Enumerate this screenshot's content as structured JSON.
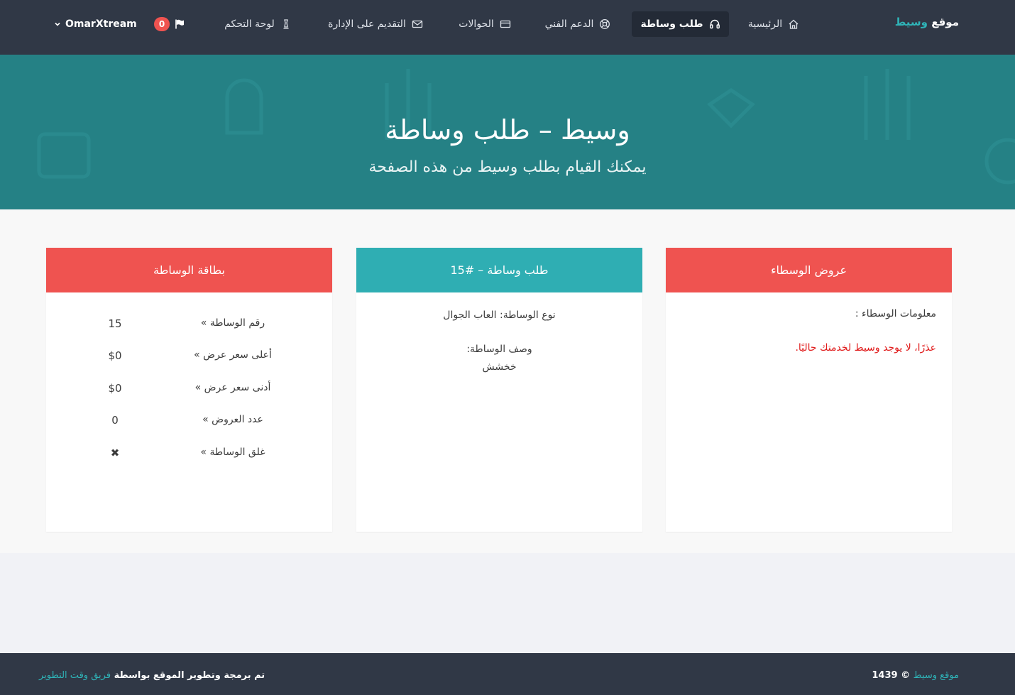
{
  "colors": {
    "navbar": "#303846",
    "accent": "#2fb3b7",
    "hero": "#258185",
    "card_red": "#ef5350",
    "card_teal": "#2faeb3",
    "error_text": "#e01b1b"
  },
  "brand": {
    "part1": "موقع",
    "part2": "وسيط"
  },
  "nav": {
    "home": {
      "label": "الرئيسية",
      "icon": "home-icon"
    },
    "request": {
      "label": "طلب وساطة",
      "icon": "headset-icon"
    },
    "support": {
      "label": "الدعم الفني",
      "icon": "lifebuoy-icon"
    },
    "transfers": {
      "label": "الحوالات",
      "icon": "credit-card-icon"
    },
    "apply": {
      "label": "التقديم على الإدارة",
      "icon": "envelope-icon"
    },
    "dashboard": {
      "label": "لوحة التحكم",
      "icon": "chess-icon"
    },
    "notifications": {
      "count": "0",
      "icon": "flag-icon"
    },
    "user": {
      "name": "OmarXtream",
      "icon": "chevron-down-icon"
    }
  },
  "hero": {
    "title": "وسيط – طلب وساطة",
    "subtitle": "يمكنك القيام بطلب وسيط من هذه الصفحة"
  },
  "cards": {
    "offers": {
      "title": "عروض الوسطاء",
      "info_label": "معلومات الوسطاء :",
      "empty_message": "عذرًا، لا يوجد وسيط لخدمتك حاليًا."
    },
    "request": {
      "title": "طلب وساطة – #15",
      "type_line": "نوع الوساطة: العاب الجوال",
      "desc_label": "وصف الوساطة:",
      "desc_value": "خخشش"
    },
    "info": {
      "title": "بطاقة الوساطة",
      "rows": [
        {
          "label": "رقم الوساطة »",
          "value": "15"
        },
        {
          "label": "أعلى سعر عرض »",
          "value": "$0"
        },
        {
          "label": "أدنى سعر عرض »",
          "value": "$0"
        },
        {
          "label": "عدد العروض »",
          "value": "0"
        },
        {
          "label": "غلق الوساطة »",
          "value": "✖"
        }
      ]
    }
  },
  "footer": {
    "copyright_link": "موقع وسيط",
    "copyright_text": "© 1439",
    "credit_text": "تم برمجة وتطوير الموقع بواسطة",
    "credit_link": "فريق وقت التطوير"
  }
}
